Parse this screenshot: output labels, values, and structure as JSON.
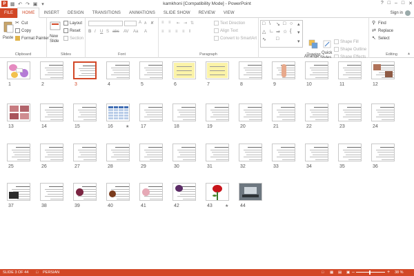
{
  "titlebar": {
    "title": "kamkhoni [Compatibility Mode] - PowerPoint",
    "logo_text": "P"
  },
  "tabs": [
    "FILE",
    "HOME",
    "INSERT",
    "DESIGN",
    "TRANSITIONS",
    "ANIMATIONS",
    "SLIDE SHOW",
    "REVIEW",
    "VIEW"
  ],
  "active_tab": "HOME",
  "account": {
    "signin": "Sign in"
  },
  "ribbon": {
    "clipboard": {
      "label": "Clipboard",
      "paste": "Paste",
      "cut": "Cut",
      "copy": "Copy",
      "format_painter": "Format Painter"
    },
    "slides": {
      "label": "Slides",
      "new_slide_1": "New",
      "new_slide_2": "Slide",
      "layout": "Layout",
      "reset": "Reset",
      "section": "Section"
    },
    "font": {
      "label": "Font"
    },
    "paragraph": {
      "label": "Paragraph",
      "text_direction": "Text Direction",
      "align_text": "Align Text",
      "convert_smartart": "Convert to SmartArt"
    },
    "drawing": {
      "label": "Drawing",
      "arrange": "Arrange",
      "quick_styles_1": "Quick",
      "quick_styles_2": "Styles",
      "shape_fill": "Shape Fill",
      "shape_outline": "Shape Outline",
      "shape_effects": "Shape Effects"
    },
    "editing": {
      "label": "Editing",
      "find": "Find",
      "replace": "Replace",
      "select": "Select"
    }
  },
  "slides": [
    {
      "n": "1",
      "kind": "flowers"
    },
    {
      "n": "2",
      "kind": "text"
    },
    {
      "n": "3",
      "kind": "text",
      "selected": true
    },
    {
      "n": "4",
      "kind": "text"
    },
    {
      "n": "5",
      "kind": "text"
    },
    {
      "n": "6",
      "kind": "yellow"
    },
    {
      "n": "7",
      "kind": "yellow"
    },
    {
      "n": "8",
      "kind": "text"
    },
    {
      "n": "9",
      "kind": "anatomy"
    },
    {
      "n": "10",
      "kind": "text"
    },
    {
      "n": "11",
      "kind": "text"
    },
    {
      "n": "12",
      "kind": "photo"
    },
    {
      "n": "13",
      "kind": "lips"
    },
    {
      "n": "14",
      "kind": "text"
    },
    {
      "n": "15",
      "kind": "text"
    },
    {
      "n": "16",
      "kind": "table",
      "star": true
    },
    {
      "n": "17",
      "kind": "text"
    },
    {
      "n": "18",
      "kind": "text"
    },
    {
      "n": "19",
      "kind": "text"
    },
    {
      "n": "20",
      "kind": "text"
    },
    {
      "n": "21",
      "kind": "text"
    },
    {
      "n": "22",
      "kind": "text"
    },
    {
      "n": "23",
      "kind": "text"
    },
    {
      "n": "24",
      "kind": "text"
    },
    {
      "n": "25",
      "kind": "text"
    },
    {
      "n": "26",
      "kind": "text"
    },
    {
      "n": "27",
      "kind": "text"
    },
    {
      "n": "28",
      "kind": "text"
    },
    {
      "n": "29",
      "kind": "text"
    },
    {
      "n": "30",
      "kind": "text"
    },
    {
      "n": "31",
      "kind": "text"
    },
    {
      "n": "32",
      "kind": "text"
    },
    {
      "n": "33",
      "kind": "text"
    },
    {
      "n": "34",
      "kind": "text"
    },
    {
      "n": "35",
      "kind": "text"
    },
    {
      "n": "36",
      "kind": "text"
    },
    {
      "n": "37",
      "kind": "dark"
    },
    {
      "n": "38",
      "kind": "text"
    },
    {
      "n": "39",
      "kind": "berry"
    },
    {
      "n": "40",
      "kind": "brown"
    },
    {
      "n": "41",
      "kind": "pink"
    },
    {
      "n": "42",
      "kind": "purple"
    },
    {
      "n": "43",
      "kind": "rose",
      "star": true
    },
    {
      "n": "44",
      "kind": "laptop"
    }
  ],
  "status": {
    "slide_info": "SLIDE 3 OF 44",
    "language": "PERSIAN",
    "zoom": "38 %"
  },
  "colors": {
    "accent": "#d24726"
  }
}
